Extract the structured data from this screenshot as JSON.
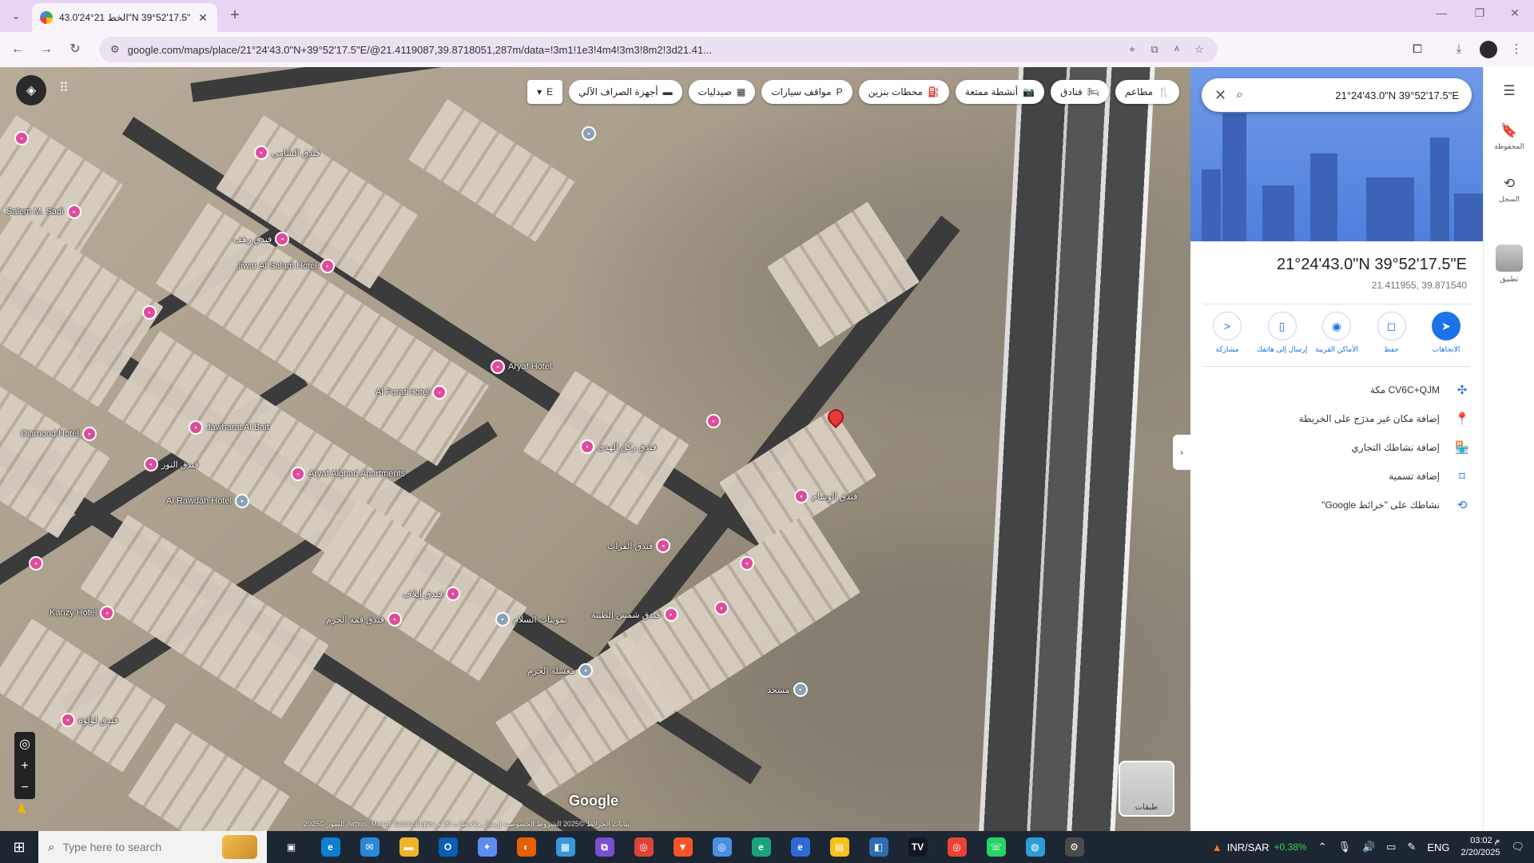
{
  "browser": {
    "tab_title": "الخط 21°24'43.0\"N 39°52'17.5\"E",
    "url": "google.com/maps/place/21°24'43.0\"N+39°52'17.5\"E/@21.4119087,39.8718051,287m/data=!3m1!1e3!4m4!3m3!8m2!3d21.41...",
    "new_tab_symbol": "+",
    "close_tab_symbol": "✕"
  },
  "map": {
    "chips": [
      {
        "label": "مطاعم",
        "icon": "restaurant-icon",
        "glyph": "🍴"
      },
      {
        "label": "فنادق",
        "icon": "hotel-icon",
        "glyph": "🛏"
      },
      {
        "label": "أنشطة ممتعة",
        "icon": "camera-icon",
        "glyph": "📷"
      },
      {
        "label": "محطات بنزين",
        "icon": "gas-icon",
        "glyph": "⛽"
      },
      {
        "label": "مواقف سيارات",
        "icon": "parking-icon",
        "glyph": "P"
      },
      {
        "label": "صيدليات",
        "icon": "pharmacy-icon",
        "glyph": "▦"
      },
      {
        "label": "أجهزة الصراف الآلي",
        "icon": "atm-icon",
        "glyph": "▬"
      }
    ],
    "chip_more_label": "E",
    "google_logo": "Google",
    "footer": "الصور ©2025 Airbus, Maxar Technologies  بيانات الخرائط ©2025  الشروط  الخصوصية  إرسال ملاحظات  20 م",
    "layer_label": "طبقات",
    "pois": [
      {
        "label": "",
        "gray": false
      },
      {
        "label": "فندق الشامي",
        "gray": false
      },
      {
        "label": "Salem M. Sadi",
        "gray": false
      },
      {
        "label": "فندق رهف",
        "gray": false
      },
      {
        "label": "Jiwar Al Salam Hotel",
        "gray": false
      },
      {
        "label": "",
        "gray": false
      },
      {
        "label": "Aryaf Hotel",
        "gray": false
      },
      {
        "label": "Al Furat Hotel",
        "gray": false
      },
      {
        "label": "Jawharat Al Bait",
        "gray": false
      },
      {
        "label": "Diamond Hotel",
        "gray": false
      },
      {
        "label": "فندق النور",
        "gray": false
      },
      {
        "label": "Aryaf Alghad Apartments",
        "gray": false
      },
      {
        "label": "Al Rawdah Hotel",
        "gray": true
      },
      {
        "label": "فندق ركن الهدى",
        "gray": false
      },
      {
        "label": "",
        "gray": false
      },
      {
        "label": "فندق الوسام",
        "gray": false
      },
      {
        "label": "",
        "gray": false
      },
      {
        "label": "",
        "gray": false
      },
      {
        "label": "Kanzy Hotel",
        "gray": false
      },
      {
        "label": "فندق قمة الحرم",
        "gray": false
      },
      {
        "label": "",
        "gray": false
      },
      {
        "label": "فندق إيلاف",
        "gray": false
      },
      {
        "label": "تموينات السلام",
        "gray": true
      },
      {
        "label": "فندق شمس الطيبة",
        "gray": false
      },
      {
        "label": "فندق لؤلؤة",
        "gray": false
      },
      {
        "label": "مسجد",
        "gray": true
      },
      {
        "label": "فندق الفرات",
        "gray": false
      },
      {
        "label": "",
        "gray": true
      },
      {
        "label": "مغسلة الحرم",
        "gray": true
      }
    ]
  },
  "panel": {
    "search_value": "21°24'43.0\"N 39°52'17.5\"E",
    "title": "21°24'43.0\"N 39°52'17.5\"E",
    "subtitle": "21.411955, 39.871540",
    "actions": [
      {
        "label": "الاتجاهات",
        "icon": "directions-icon",
        "glyph": "➤",
        "primary": true
      },
      {
        "label": "حفظ",
        "icon": "bookmark-icon",
        "glyph": "◻",
        "primary": false
      },
      {
        "label": "الأماكن القريبة",
        "icon": "nearby-icon",
        "glyph": "◉",
        "primary": false
      },
      {
        "label": "إرسال إلى هاتفك",
        "icon": "phone-icon",
        "glyph": "▯",
        "primary": false
      },
      {
        "label": "مشاركة",
        "icon": "share-icon",
        "glyph": "<",
        "primary": false
      }
    ],
    "info": [
      {
        "text": "CV6C+QJM مكة",
        "icon": "plus-code-icon",
        "glyph": "✣"
      },
      {
        "text": "إضافة مكان غير مدرَج على الخريطة",
        "icon": "add-place-icon",
        "glyph": "📍"
      },
      {
        "text": "إضافة نشاطك التجاري",
        "icon": "storefront-icon",
        "glyph": "🏪"
      },
      {
        "text": "إضافة تسمية",
        "icon": "label-icon",
        "glyph": "⌑"
      },
      {
        "text": "نشاطك على \"خرائط Google\"",
        "icon": "history-icon",
        "glyph": "⟲"
      }
    ]
  },
  "rail": {
    "items": [
      {
        "label": "",
        "icon": "menu-icon",
        "glyph": "☰"
      },
      {
        "label": "المحفوظة",
        "icon": "saved-icon",
        "glyph": "🔖"
      },
      {
        "label": "السجل",
        "icon": "recent-icon",
        "glyph": "⟲"
      },
      {
        "label": "تطبيق",
        "icon": "app-thumb-icon",
        "glyph": ""
      }
    ]
  },
  "taskbar": {
    "search_placeholder": "Type here to search",
    "apps": [
      {
        "icon": "task-view-icon",
        "color": "#1c2733",
        "glyph": "▣"
      },
      {
        "icon": "edge-icon",
        "color": "#0e7fd2",
        "glyph": "e"
      },
      {
        "icon": "mail-app-icon",
        "color": "#2b88d8",
        "glyph": "✉"
      },
      {
        "icon": "file-explorer-icon",
        "color": "#f0b429",
        "glyph": "▬"
      },
      {
        "icon": "outlook-icon",
        "color": "#0a5fb4",
        "glyph": "O"
      },
      {
        "icon": "copilot-icon",
        "color": "#5d8df2",
        "glyph": "✦"
      },
      {
        "icon": "firefox-icon",
        "color": "#e66000",
        "glyph": "◐"
      },
      {
        "icon": "store-icon",
        "color": "#3a96dd",
        "glyph": "▦"
      },
      {
        "icon": "visual-studio-icon",
        "color": "#7b4fd1",
        "glyph": "⧉"
      },
      {
        "icon": "chrome-icon",
        "color": "#db4437",
        "glyph": "◎"
      },
      {
        "icon": "brave-icon",
        "color": "#fb542b",
        "glyph": "▼"
      },
      {
        "icon": "chromium-icon",
        "color": "#4a90e2",
        "glyph": "◎"
      },
      {
        "icon": "edge-beta-icon",
        "color": "#1aa37a",
        "glyph": "e"
      },
      {
        "icon": "edge-dev-icon",
        "color": "#2d6ad6",
        "glyph": "e"
      },
      {
        "icon": "sticky-notes-icon",
        "color": "#f6c21c",
        "glyph": "▤"
      },
      {
        "icon": "photos-icon",
        "color": "#2e6cb5",
        "glyph": "◧"
      },
      {
        "icon": "tradingview-icon",
        "color": "#131722",
        "glyph": "TV"
      },
      {
        "icon": "chrome-alt-icon",
        "color": "#ea4335",
        "glyph": "◎"
      },
      {
        "icon": "whatsapp-icon",
        "color": "#25d366",
        "glyph": "☏"
      },
      {
        "icon": "globe-icon",
        "color": "#2a9fd6",
        "glyph": "◍"
      },
      {
        "icon": "settings-icon",
        "color": "#4b4b4b",
        "glyph": "⚙"
      }
    ],
    "ticker_label": "INR/SAR",
    "ticker_change": "+0.38%",
    "lang": "ENG",
    "time": "03:02 م",
    "date": "2/20/2025"
  }
}
